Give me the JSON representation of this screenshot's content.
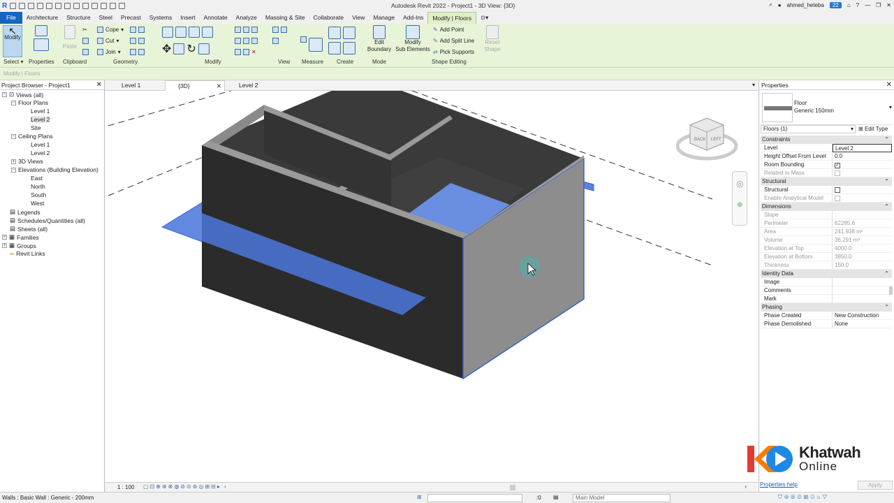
{
  "title_bar": {
    "app_title": "Autodesk Revit 2022 - Project1 - 3D View: {3D}",
    "user": "ahmed_heteba",
    "notifications": "22"
  },
  "ribbon_tabs": [
    "File",
    "Architecture",
    "Structure",
    "Steel",
    "Precast",
    "Systems",
    "Insert",
    "Annotate",
    "Analyze",
    "Massing & Site",
    "Collaborate",
    "View",
    "Manage",
    "Add-Ins",
    "Modify | Floors"
  ],
  "ribbon": {
    "modify": "Modify",
    "paste": "Paste",
    "cope": "Cope",
    "cut": "Cut",
    "join": "Join",
    "edit_boundary": "Edit\nBoundary",
    "modify_sub": "Modify\nSub Elements",
    "add_point": "Add Point",
    "add_split_line": "Add Split Line",
    "pick_supports": "Pick Supports",
    "reset_shape": "Reset\nShape",
    "panels": {
      "select": "Select",
      "properties": "Properties",
      "clipboard": "Clipboard",
      "geometry": "Geometry",
      "modify": "Modify",
      "view": "View",
      "measure": "Measure",
      "create": "Create",
      "mode": "Mode",
      "shape_editing": "Shape Editing"
    }
  },
  "options_bar": "Modify | Floors",
  "project_browser": {
    "title": "Project Browser - Project1",
    "views_all": "Views (all)",
    "floor_plans": "Floor Plans",
    "fp_level1": "Level 1",
    "fp_level2": "Level 2",
    "fp_site": "Site",
    "ceiling_plans": "Ceiling Plans",
    "cp_level1": "Level 1",
    "cp_level2": "Level 2",
    "views_3d": "3D Views",
    "elevations": "Elevations (Building Elevation)",
    "east": "East",
    "north": "North",
    "south": "South",
    "west": "West",
    "legends": "Legends",
    "schedules": "Schedules/Quantities (all)",
    "sheets": "Sheets (all)",
    "families": "Families",
    "groups": "Groups",
    "revit_links": "Revit Links"
  },
  "view_tabs": [
    "Level 1",
    "{3D}",
    "Level 2"
  ],
  "view_bar": {
    "scale": "1 : 100"
  },
  "view_cube": {
    "back": "BACK",
    "left": "LEFT"
  },
  "properties": {
    "title": "Properties",
    "family": "Floor",
    "type": "Generic 150mm",
    "selector": "Floors (1)",
    "edit_type": "Edit Type",
    "groups": {
      "constraints": "Constraints",
      "structural": "Structural",
      "dimensions": "Dimensions",
      "identity": "Identity Data",
      "phasing": "Phasing"
    },
    "rows": {
      "level": [
        "Level",
        "Level 2"
      ],
      "height_offset": [
        "Height Offset From Level",
        "0.0"
      ],
      "room_bounding": [
        "Room Bounding",
        ""
      ],
      "related_mass": [
        "Related to Mass",
        ""
      ],
      "structural": [
        "Structural",
        ""
      ],
      "analytical": [
        "Enable Analytical Model",
        ""
      ],
      "slope": [
        "Slope",
        ""
      ],
      "perimeter": [
        "Perimeter",
        "62285.6"
      ],
      "area": [
        "Area",
        "241.938 m²"
      ],
      "volume": [
        "Volume",
        "36.291 m³"
      ],
      "elev_top": [
        "Elevation at Top",
        "4000.0"
      ],
      "elev_bottom": [
        "Elevation at Bottom",
        "3850.0"
      ],
      "thickness": [
        "Thickness",
        "150.0"
      ],
      "image": [
        "Image",
        ""
      ],
      "comments": [
        "Comments",
        ""
      ],
      "mark": [
        "Mark",
        ""
      ],
      "phase_created": [
        "Phase Created",
        "New Construction"
      ],
      "phase_demolished": [
        "Phase Demolished",
        "None"
      ]
    },
    "help": "Properties help",
    "apply": "Apply"
  },
  "status_bar": {
    "message": "Walls : Basic Wall : Generic - 200mm",
    "zero": ":0",
    "model": "Main Model"
  },
  "logo": {
    "line1": "Khatwah",
    "line2": "Online"
  },
  "colors": {
    "accent": "#1565c0",
    "ribbon": "#e8f4d8",
    "selection": "#4a78d6"
  }
}
